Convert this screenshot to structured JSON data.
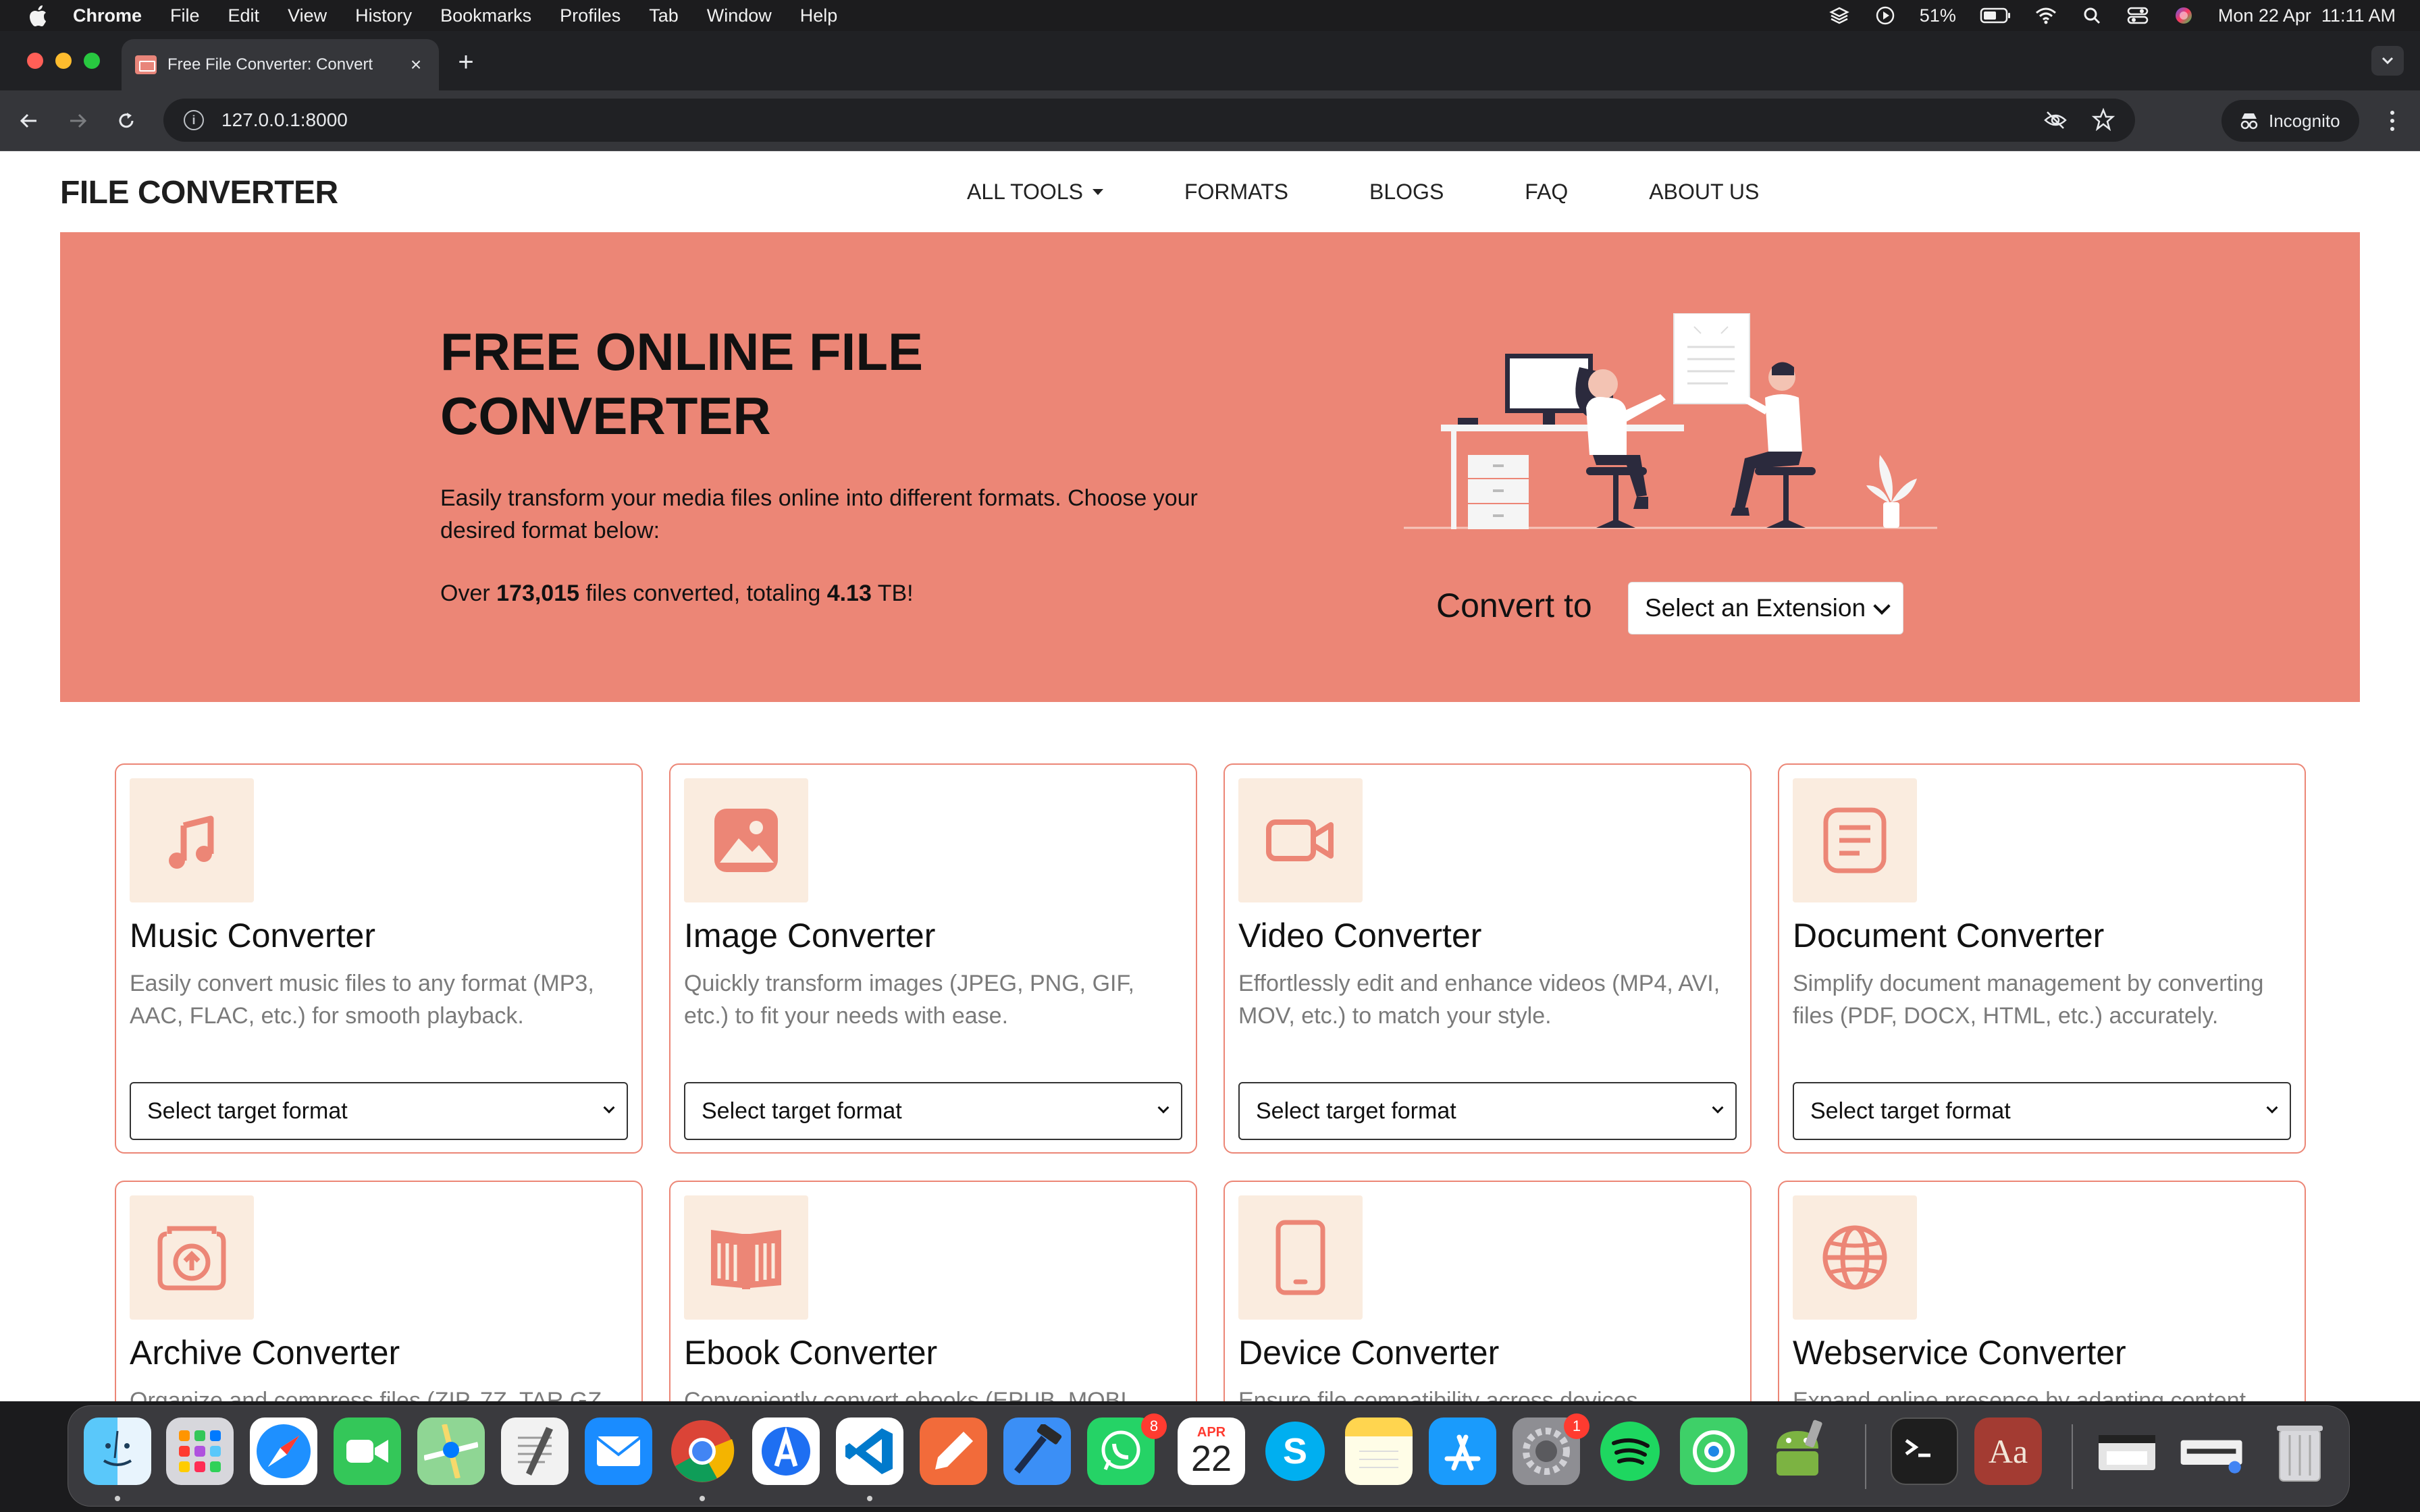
{
  "menubar": {
    "app_name": "Chrome",
    "items": [
      "File",
      "Edit",
      "View",
      "History",
      "Bookmarks",
      "Profiles",
      "Tab",
      "Window",
      "Help"
    ],
    "battery": "51%",
    "datetime": "Mon 22 Apr  11:11 AM"
  },
  "browser": {
    "tab_title": "Free File Converter: Convert",
    "url": "127.0.0.1:8000",
    "incognito_label": "Incognito"
  },
  "site": {
    "logo": "FILE CONVERTER",
    "nav": [
      "ALL TOOLS",
      "FORMATS",
      "BLOGS",
      "FAQ",
      "ABOUT US"
    ],
    "hero": {
      "title_line1": "FREE ONLINE FILE",
      "title_line2": "CONVERTER",
      "description": "Easily transform your media files online into different formats. Choose your desired format below:",
      "stats_prefix": "Over ",
      "files_count": "173,015",
      "stats_middle": " files converted, totaling ",
      "total_size": "4.13",
      "stats_suffix": " TB!",
      "convert_label": "Convert to",
      "extension_select": "Select an Extension"
    },
    "cards": [
      {
        "title": "Music Converter",
        "description": "Easily convert music files to any format (MP3, AAC, FLAC, etc.) for smooth playback.",
        "select": "Select target format",
        "icon": "music-note-icon"
      },
      {
        "title": "Image Converter",
        "description": "Quickly transform images (JPEG, PNG, GIF, etc.) to fit your needs with ease.",
        "select": "Select target format",
        "icon": "image-icon"
      },
      {
        "title": "Video Converter",
        "description": "Effortlessly edit and enhance videos (MP4, AVI, MOV, etc.) to match your style.",
        "select": "Select target format",
        "icon": "video-camera-icon"
      },
      {
        "title": "Document Converter",
        "description": "Simplify document management by converting files (PDF, DOCX, HTML, etc.) accurately.",
        "select": "Select target format",
        "icon": "document-icon"
      },
      {
        "title": "Archive Converter",
        "description": "Organize and compress files (ZIP, 7Z, TAR.GZ",
        "icon": "archive-upload-icon"
      },
      {
        "title": "Ebook Converter",
        "description": "Conveniently convert ebooks (EPUB, MOBI",
        "icon": "open-book-icon"
      },
      {
        "title": "Device Converter",
        "description": "Ensure file compatibility across devices",
        "icon": "tablet-icon"
      },
      {
        "title": "Webservice Converter",
        "description": "Expand online presence by adapting content",
        "icon": "globe-icon"
      }
    ]
  },
  "dock": {
    "calendar_month": "APR",
    "calendar_day": "22",
    "whatsapp_badge": "8",
    "settings_badge": "1",
    "dictionary_label": "Aa"
  },
  "colors": {
    "accent": "#ec8676",
    "icon_bg": "#faecdf",
    "muted_text": "#7a7a7a"
  }
}
